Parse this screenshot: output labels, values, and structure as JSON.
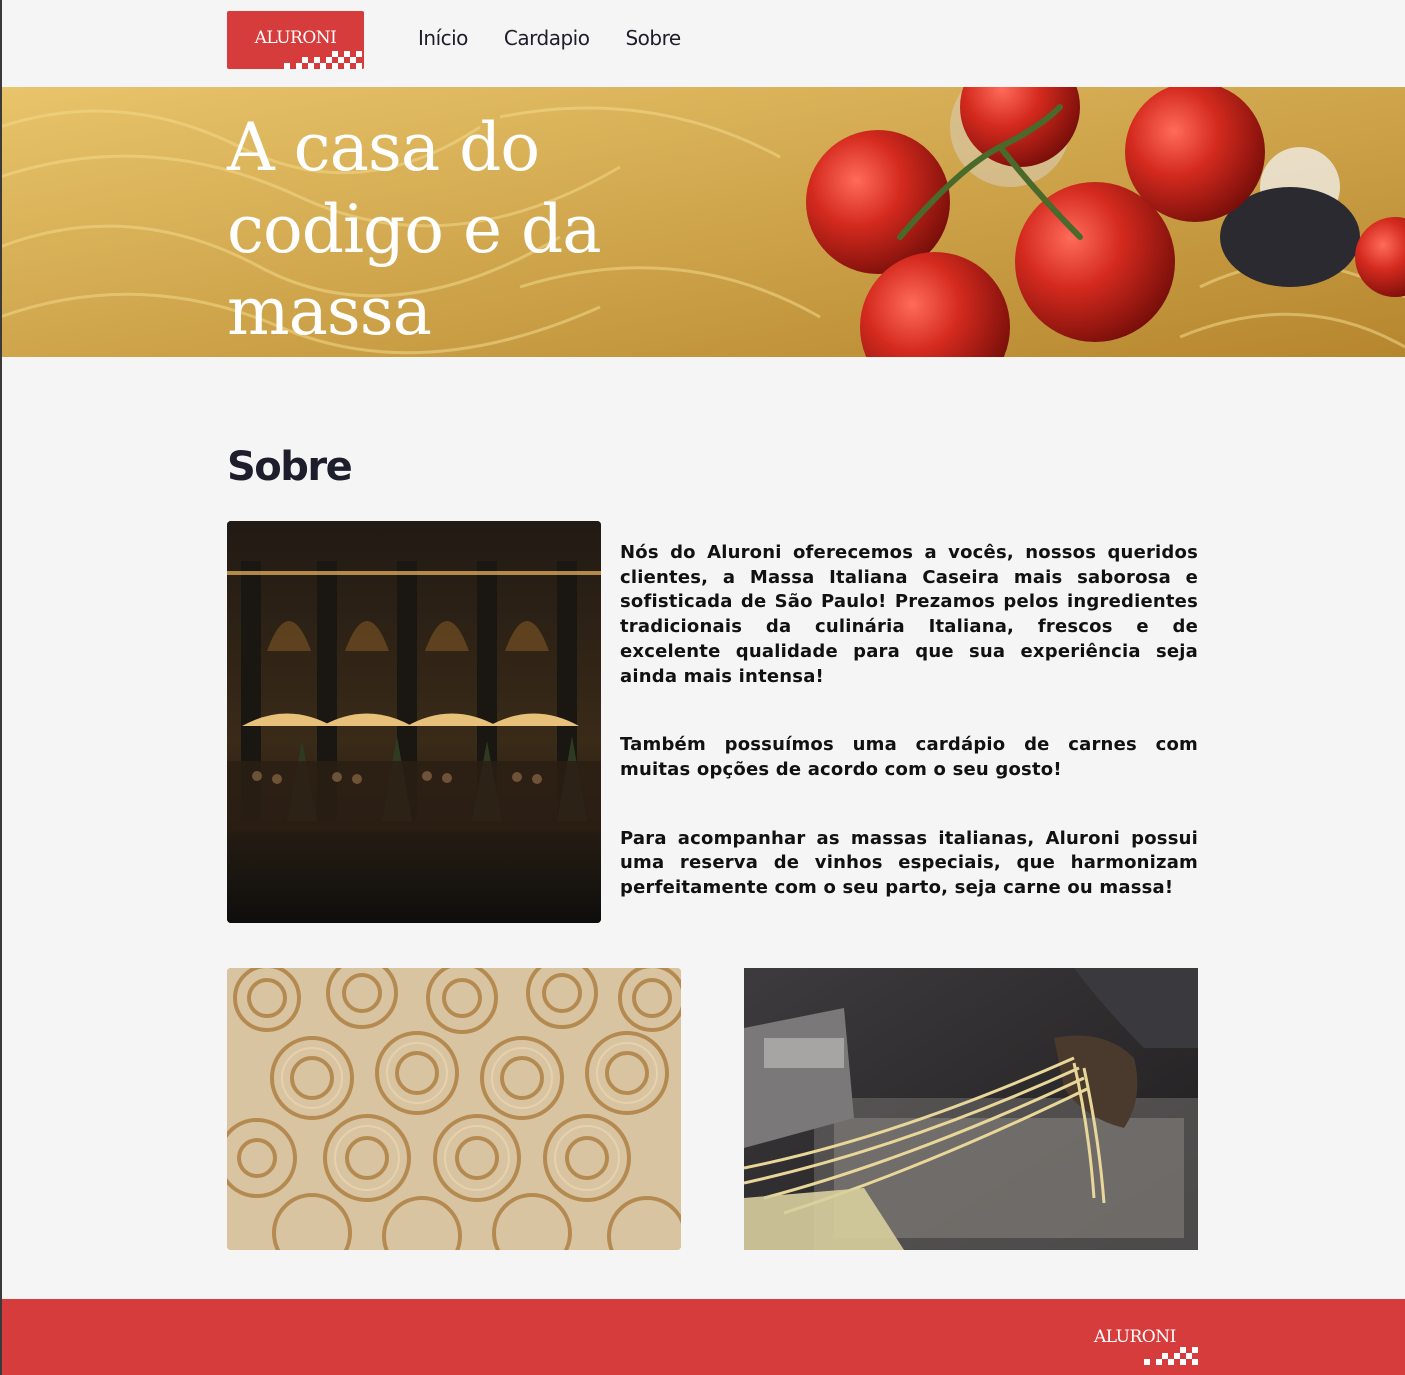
{
  "brand": {
    "name": "ALURONI",
    "color": "#d63c3b"
  },
  "nav": {
    "items": [
      {
        "label": "Início"
      },
      {
        "label": "Cardapio"
      },
      {
        "label": "Sobre"
      }
    ]
  },
  "hero": {
    "title": "A casa do codigo e da massa"
  },
  "about": {
    "title": "Sobre",
    "paragraphs": [
      "Nós do Aluroni oferecemos a vocês, nossos queridos clientes, a Massa Italiana Caseira mais saborosa e sofisticada de São Paulo! Prezamos pelos ingredientes tradicionais da culinária Italiana, frescos e de excelente qualidade para que sua experiência seja ainda mais intensa!",
      "Também possuímos uma cardápio de carnes com muitas opções de acordo com o seu gosto!",
      "Para acompanhar as massas italianas, Aluroni possui uma reserva de vinhos especiais, que harmonizam perfeitamente com o seu parto, seja carne ou massa!"
    ]
  },
  "images": {
    "hero": "pasta-tomatoes-photo",
    "restaurant": "restaurant-terrace-photo",
    "nests": "pasta-nests-photo",
    "chef": "chef-hands-pasta-photo"
  },
  "footer": {
    "logo": "ALURONI"
  }
}
